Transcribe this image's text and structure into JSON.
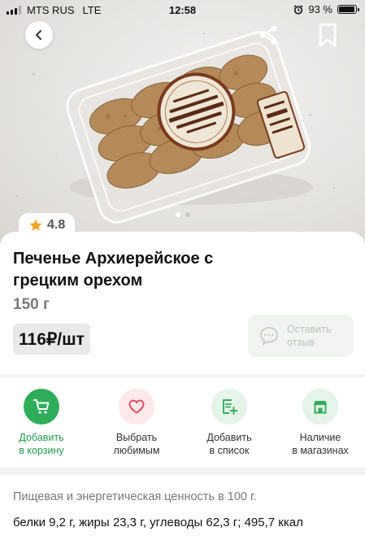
{
  "status_bar": {
    "carrier": "MTS RUS",
    "network": "LTE",
    "time": "12:58",
    "battery_percent": "93 %",
    "battery_level": 0.93
  },
  "hero": {
    "image_alt": "Печенье Архиерейское с грецким орехом",
    "slide_count": 2,
    "active_slide": 1
  },
  "product": {
    "rating": "4.8",
    "title": "Печенье Архиерейское с грецким орехом",
    "weight": "150 г",
    "price": "116₽/шт",
    "review_button": "Оставить отзыв"
  },
  "actions": [
    {
      "label": "Добавить в корзину",
      "icon": "cart-icon"
    },
    {
      "label": "Выбрать любимым",
      "icon": "heart-icon"
    },
    {
      "label": "Добавить в список",
      "icon": "list-add-icon"
    },
    {
      "label": "Наличие в магазинах",
      "icon": "store-icon"
    }
  ],
  "nutrition": {
    "heading": "Пищевая и энергетическая ценность в 100 г.",
    "values": "белки 9,2 г, жиры 23,3 г, углеводы 62,3 г; 495,7 ккал"
  },
  "colors": {
    "accent_green": "#1e9a4d",
    "green_circle": "#2fae5a",
    "pink_circle": "#fde8ea",
    "heart": "#e34a5c",
    "light_green_circle": "#e4f4e8",
    "star": "#f5a524"
  }
}
